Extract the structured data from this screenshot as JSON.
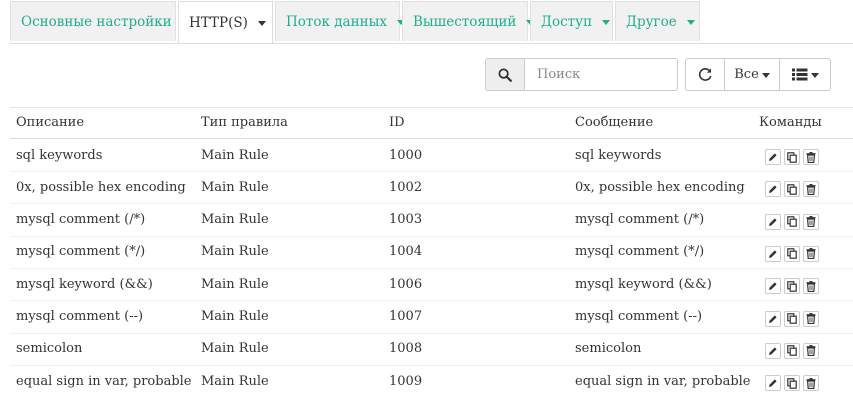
{
  "tabs": [
    {
      "label": "Основные настройки",
      "active": false
    },
    {
      "label": "HTTP(S)",
      "active": true
    },
    {
      "label": "Поток данных",
      "active": false
    },
    {
      "label": "Вышестоящий",
      "active": false
    },
    {
      "label": "Доступ",
      "active": false
    },
    {
      "label": "Другое",
      "active": false
    }
  ],
  "toolbar": {
    "search_placeholder": "Поиск",
    "filter_label": "Все",
    "refresh_icon": "refresh-icon",
    "columns_icon": "list-icon"
  },
  "table": {
    "headers": [
      "Описание",
      "Тип правила",
      "ID",
      "Сообщение",
      "Команды"
    ],
    "rows": [
      {
        "description": "sql keywords",
        "type": "Main Rule",
        "id": "1000",
        "message": "sql keywords"
      },
      {
        "description": "0x, possible hex encoding",
        "type": "Main Rule",
        "id": "1002",
        "message": "0x, possible hex encoding"
      },
      {
        "description": "mysql comment (/*)",
        "type": "Main Rule",
        "id": "1003",
        "message": "mysql comment (/*)"
      },
      {
        "description": "mysql comment (*/)",
        "type": "Main Rule",
        "id": "1004",
        "message": "mysql comment (*/)"
      },
      {
        "description": "mysql keyword (&&)",
        "type": "Main Rule",
        "id": "1006",
        "message": "mysql keyword (&&)"
      },
      {
        "description": "mysql comment (--)",
        "type": "Main Rule",
        "id": "1007",
        "message": "mysql comment (--)"
      },
      {
        "description": "semicolon",
        "type": "Main Rule",
        "id": "1008",
        "message": "semicolon"
      },
      {
        "description": "equal sign in var, probable s…",
        "type": "Main Rule",
        "id": "1009",
        "message": "equal sign in var, probable s…"
      }
    ]
  },
  "colors": {
    "accent": "#1fae8e",
    "tab_bg": "#f1f1f1"
  }
}
